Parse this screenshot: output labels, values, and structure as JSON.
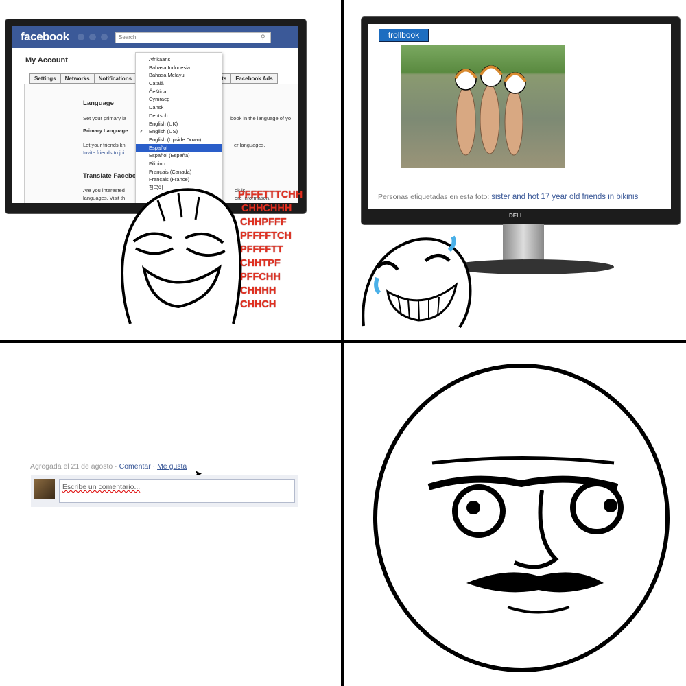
{
  "panel1": {
    "brand": "facebook",
    "search_placeholder": "Search",
    "page_title": "My Account",
    "tabs": [
      "Settings",
      "Networks",
      "Notifications",
      "Payments",
      "Facebook Ads"
    ],
    "section_language": "Language",
    "set_primary_text": "Set your primary la",
    "set_primary_text_end": "book in the language of yo",
    "primary_language_label": "Primary Language:",
    "friends_text": "Let your friends kn",
    "friends_text_end": "er languages.",
    "invite_link": "Invite friends to joi",
    "section_translate": "Translate Facebo",
    "interested_text": "Are you interested",
    "interested_end": "ok is",
    "languages_text": "languages. Visit th",
    "languages_end": "ore information.",
    "language_options": [
      "Afrikaans",
      "Bahasa Indonesia",
      "Bahasa Melayu",
      "Català",
      "Čeština",
      "Cymraeg",
      "Dansk",
      "Deutsch",
      "English (UK)",
      "English (US)",
      "English (Upside Down)",
      "Español",
      "Español (España)",
      "Filipino",
      "Français (Canada)",
      "Français (France)",
      "한국어"
    ],
    "checked_option": "English (US)",
    "highlighted_option": "Español",
    "checkmark": "✓",
    "laugh_text": [
      "PFFFTTTCHH",
      "CHHCHHH",
      "CHHPFFF",
      "PFFFFTCH",
      "PFFFFTT",
      "CHHTPF",
      "PFFCHH",
      "CHHHH",
      "CHHCH"
    ],
    "laugh_color": "#e03020"
  },
  "panel2": {
    "tag_label": "trollbook",
    "caption_label": "Personas etiquetadas en esta foto:",
    "caption_value": "sister and hot 17 year old friends in bikinis",
    "monitor_brand": "DELL"
  },
  "panel3": {
    "added_text": "Agregada el 21 de agosto ·",
    "comment_link": "Comentar",
    "separator": "·",
    "like_link": "Me gusta",
    "comment_placeholder": "Escribe un comentario..."
  },
  "colors": {
    "facebook_blue": "#3b5998",
    "highlight": "#2a5ec9"
  }
}
